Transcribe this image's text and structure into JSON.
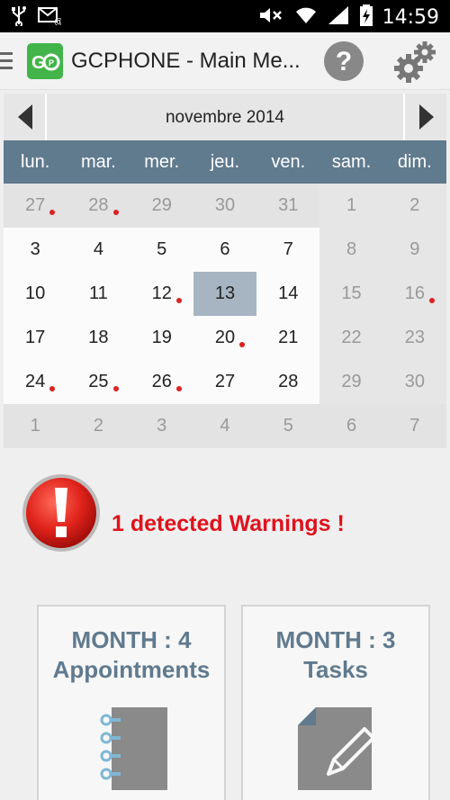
{
  "status": {
    "time": "14:59"
  },
  "app": {
    "title": "GCPHONE - Main Me..."
  },
  "calendar": {
    "month_label": "novembre 2014",
    "weekdays": [
      "lun.",
      "mar.",
      "mer.",
      "jeu.",
      "ven.",
      "sam.",
      "dim."
    ],
    "weeks": [
      [
        {
          "d": "27",
          "type": "muted",
          "dot": true
        },
        {
          "d": "28",
          "type": "muted",
          "dot": true
        },
        {
          "d": "29",
          "type": "muted"
        },
        {
          "d": "30",
          "type": "muted"
        },
        {
          "d": "31",
          "type": "muted"
        },
        {
          "d": "1",
          "type": "weekend"
        },
        {
          "d": "2",
          "type": "weekend"
        }
      ],
      [
        {
          "d": "3",
          "type": "current"
        },
        {
          "d": "4",
          "type": "current"
        },
        {
          "d": "5",
          "type": "current"
        },
        {
          "d": "6",
          "type": "current"
        },
        {
          "d": "7",
          "type": "current"
        },
        {
          "d": "8",
          "type": "weekend"
        },
        {
          "d": "9",
          "type": "weekend"
        }
      ],
      [
        {
          "d": "10",
          "type": "current"
        },
        {
          "d": "11",
          "type": "current"
        },
        {
          "d": "12",
          "type": "current",
          "dot": true
        },
        {
          "d": "13",
          "type": "today"
        },
        {
          "d": "14",
          "type": "current"
        },
        {
          "d": "15",
          "type": "weekend"
        },
        {
          "d": "16",
          "type": "weekend",
          "dot": true
        }
      ],
      [
        {
          "d": "17",
          "type": "current"
        },
        {
          "d": "18",
          "type": "current"
        },
        {
          "d": "19",
          "type": "current"
        },
        {
          "d": "20",
          "type": "current",
          "dot": true
        },
        {
          "d": "21",
          "type": "current"
        },
        {
          "d": "22",
          "type": "weekend"
        },
        {
          "d": "23",
          "type": "weekend"
        }
      ],
      [
        {
          "d": "24",
          "type": "current",
          "dot": true
        },
        {
          "d": "25",
          "type": "current",
          "dot": true
        },
        {
          "d": "26",
          "type": "current",
          "dot": true
        },
        {
          "d": "27",
          "type": "current"
        },
        {
          "d": "28",
          "type": "current"
        },
        {
          "d": "29",
          "type": "weekend"
        },
        {
          "d": "30",
          "type": "weekend"
        }
      ],
      [
        {
          "d": "1",
          "type": "muted"
        },
        {
          "d": "2",
          "type": "muted"
        },
        {
          "d": "3",
          "type": "muted"
        },
        {
          "d": "4",
          "type": "muted"
        },
        {
          "d": "5",
          "type": "muted"
        },
        {
          "d": "6",
          "type": "muted"
        },
        {
          "d": "7",
          "type": "muted"
        }
      ]
    ]
  },
  "warning": {
    "text": "1 detected Warnings !"
  },
  "cards": {
    "appointments": {
      "line1": "MONTH : 4",
      "line2": "Appointments",
      "icon": "notebook-icon"
    },
    "tasks": {
      "line1": "MONTH : 3",
      "line2": "Tasks",
      "icon": "edit-document-icon"
    }
  },
  "colors": {
    "accent": "#607a8e",
    "warning": "#e0121b",
    "event_dot": "#dd2222",
    "logo": "#43b449",
    "today_highlight": "#a6b5c1"
  }
}
